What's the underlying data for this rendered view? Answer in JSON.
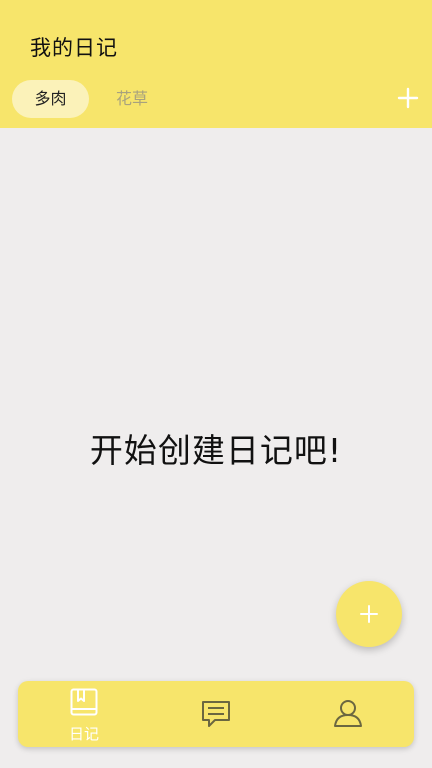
{
  "header": {
    "title": "我的日记"
  },
  "tabs": [
    {
      "label": "多肉",
      "active": true
    },
    {
      "label": "花草",
      "active": false
    }
  ],
  "icons": {
    "add_category": "plus-icon",
    "fab": "plus-icon",
    "nav_diary": "book-icon",
    "nav_messages": "message-icon",
    "nav_profile": "user-icon"
  },
  "main": {
    "empty_message": "开始创建日记吧!"
  },
  "bottom_nav": {
    "items": [
      {
        "label": "日记",
        "active": true
      },
      {
        "label": "",
        "active": false
      },
      {
        "label": "",
        "active": false
      }
    ]
  },
  "colors": {
    "header_bg": "#F7E56B",
    "active_tab_bg": "#FBF2B9",
    "inactive_tab_text": "#A8A27E",
    "page_bg": "#EFEDED",
    "active_nav": "#FFFFFF",
    "inactive_nav": "#6B6740"
  }
}
